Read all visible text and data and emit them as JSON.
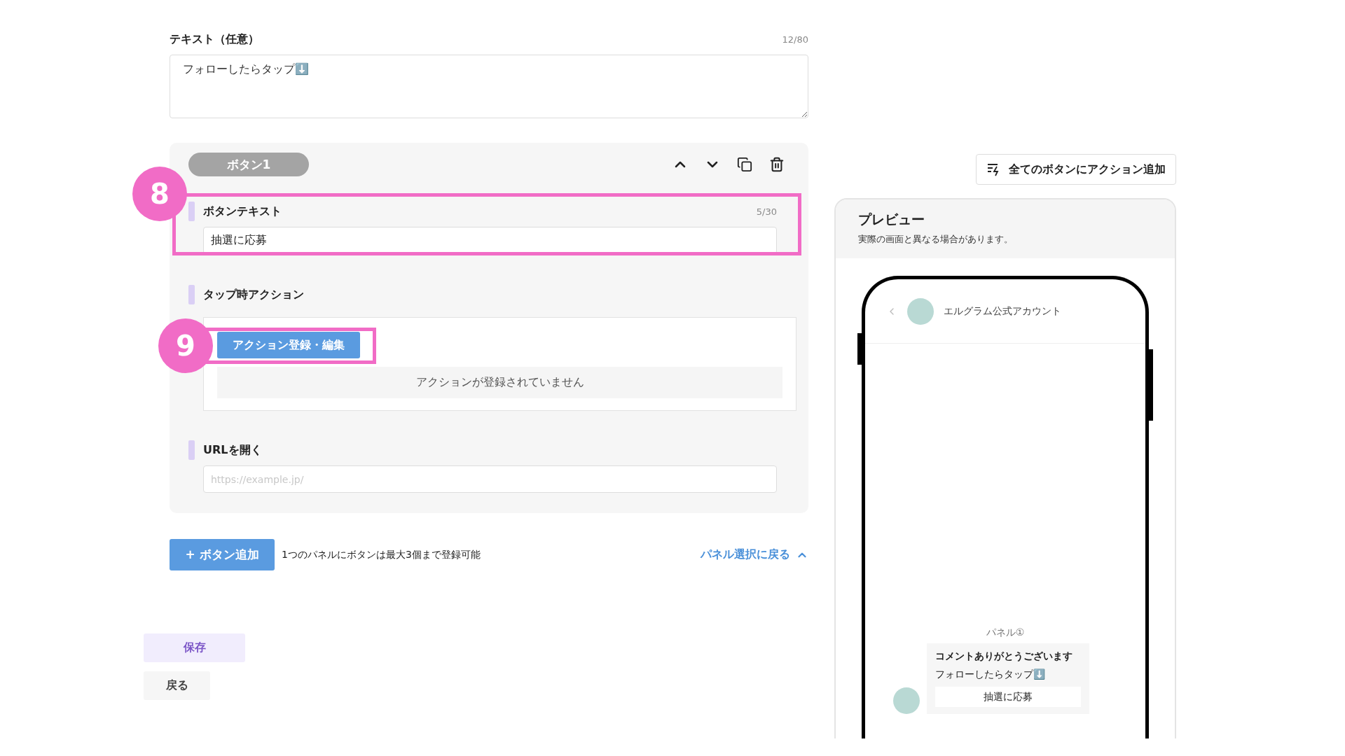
{
  "text_field": {
    "label": "テキスト（任意）",
    "counter": "12/80",
    "value": "フォローしたらタップ⬇️"
  },
  "button_panel": {
    "tab": "ボタン1",
    "button_text": {
      "label": "ボタンテキスト",
      "counter": "5/30",
      "value": "抽選に応募"
    },
    "tap_action": {
      "label": "タップ時アクション",
      "button": "アクション登録・編集",
      "empty_message": "アクションが登録されていません"
    },
    "url": {
      "label": "URLを開く",
      "placeholder": "https://example.jp/"
    }
  },
  "annotations": [
    {
      "label": "8"
    },
    {
      "label": "9"
    }
  ],
  "add_row": {
    "button": "+ ボタン追加",
    "note": "1つのパネルにボタンは最大3個まで登録可能",
    "link": "パネル選択に戻る"
  },
  "footer_buttons": [
    {
      "kind": "primary",
      "label": "保存"
    },
    {
      "kind": "secondary",
      "label": "戻る"
    }
  ],
  "add_action_all": "全てのボタンにアクション追加",
  "preview": {
    "title": "プレビュー",
    "note": "実際の画面と異なる場合があります。",
    "account_name": "エルグラム公式アカウント",
    "panel_label": "パネル①",
    "message": {
      "title": "コメントありがとうございます",
      "text": "フォローしたらタップ⬇️",
      "button": "抽選に応募"
    }
  }
}
